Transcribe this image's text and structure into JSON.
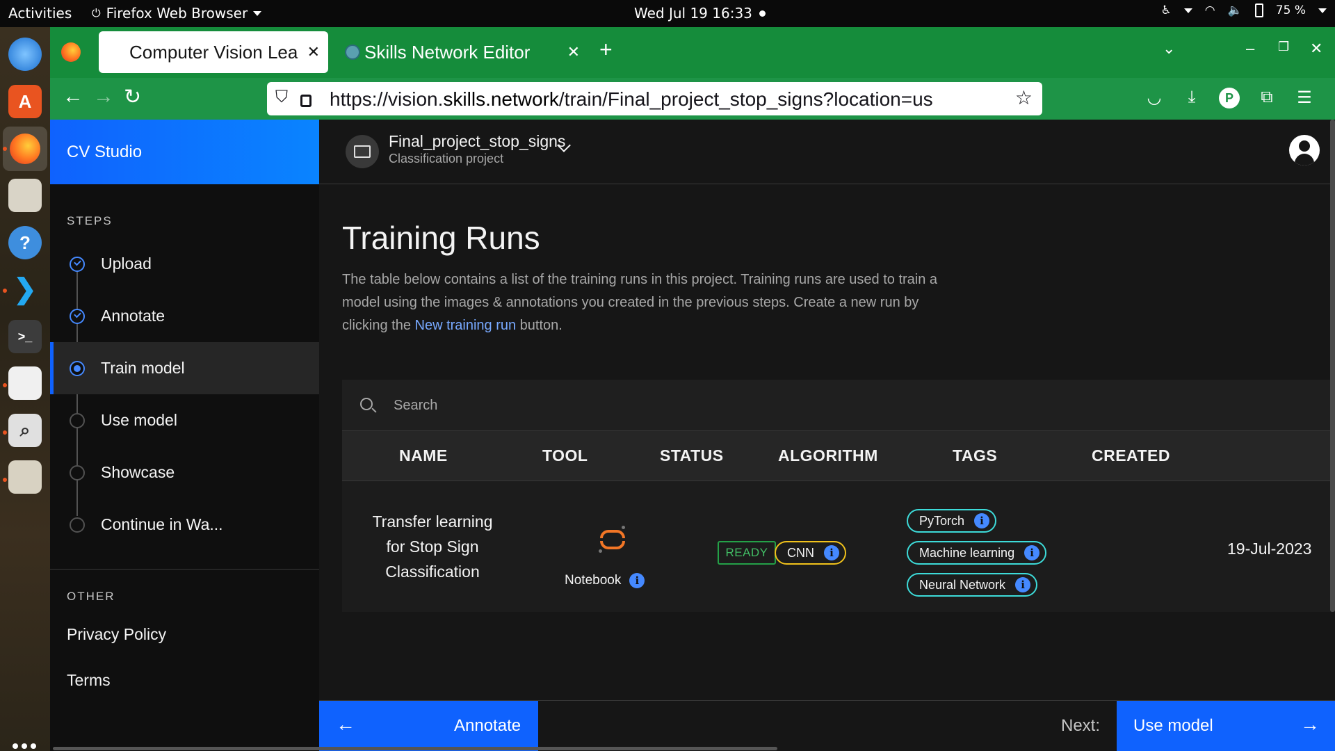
{
  "os": {
    "activities": "Activities",
    "app_menu": "Firefox Web Browser",
    "clock": "Wed Jul 19  16:33",
    "battery": "75 %"
  },
  "browser": {
    "tabs": [
      {
        "label": "Computer Vision Lea",
        "active": true
      },
      {
        "label": "Skills Network Editor",
        "active": false
      }
    ],
    "url_prefix": "https://vision.",
    "url_host": "skills.network",
    "url_path": "/train/Final_project_stop_signs?location=us"
  },
  "sidebar": {
    "brand": "CV Studio",
    "steps_heading": "STEPS",
    "steps": [
      {
        "label": "Upload",
        "state": "done"
      },
      {
        "label": "Annotate",
        "state": "done"
      },
      {
        "label": "Train model",
        "state": "current"
      },
      {
        "label": "Use model",
        "state": "todo"
      },
      {
        "label": "Showcase",
        "state": "todo"
      },
      {
        "label": "Continue in Wa...",
        "state": "todo"
      }
    ],
    "other_heading": "OTHER",
    "other_links": [
      "Privacy Policy",
      "Terms"
    ]
  },
  "header": {
    "project_name": "Final_project_stop_signs",
    "project_type": "Classification project"
  },
  "main": {
    "title": "Training Runs",
    "description_before": "The table below contains a list of the training runs in this project. Training runs are used to train a model using the images & annotations you created in the previous steps. Create a new run by clicking the ",
    "description_link": "New training run",
    "description_after": " button.",
    "search_placeholder": "Search",
    "columns": [
      "NAME",
      "TOOL",
      "STATUS",
      "ALGORITHM",
      "TAGS",
      "CREATED"
    ],
    "rows": [
      {
        "name": "Transfer learning for Stop Sign Classification",
        "tool": "Notebook",
        "status": "READY",
        "algorithm": "CNN",
        "tags": [
          "PyTorch",
          "Machine learning",
          "Neural Network"
        ],
        "created": "19-Jul-2023"
      }
    ]
  },
  "footer": {
    "prev_label": "Annotate",
    "next_prefix": "Next:",
    "next_label": "Use model"
  },
  "colors": {
    "accent": "#0f62fe",
    "browser_green": "#158c3b",
    "status_ready": "#42be65",
    "algorithm_border": "#f1c21b",
    "tag_border": "#3ddbd9"
  }
}
